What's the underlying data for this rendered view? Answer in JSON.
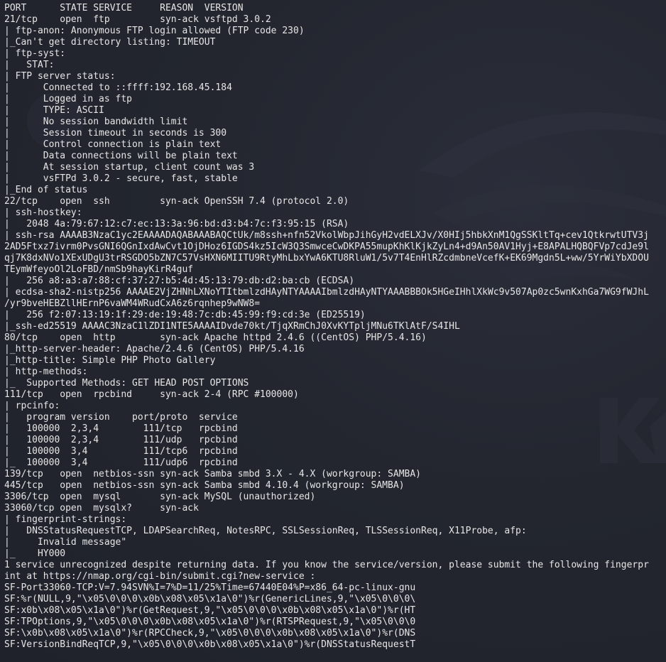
{
  "colors": {
    "background": "#22252f",
    "text": "#e6e6e6"
  },
  "terminal": {
    "lines": [
      "PORT      STATE SERVICE     REASON  VERSION",
      "21/tcp    open  ftp         syn-ack vsftpd 3.0.2",
      "| ftp-anon: Anonymous FTP login allowed (FTP code 230)",
      "|_Can't get directory listing: TIMEOUT",
      "| ftp-syst:",
      "|   STAT:",
      "| FTP server status:",
      "|      Connected to ::ffff:192.168.45.184",
      "|      Logged in as ftp",
      "|      TYPE: ASCII",
      "|      No session bandwidth limit",
      "|      Session timeout in seconds is 300",
      "|      Control connection is plain text",
      "|      Data connections will be plain text",
      "|      At session startup, client count was 3",
      "|      vsFTPd 3.0.2 - secure, fast, stable",
      "|_End of status",
      "22/tcp    open  ssh         syn-ack OpenSSH 7.4 (protocol 2.0)",
      "| ssh-hostkey:",
      "|   2048 4a:79:67:12:c7:ec:13:3a:96:bd:d3:b4:7c:f3:95:15 (RSA)",
      "| ssh-rsa AAAAB3NzaC1yc2EAAAADAQABAAABAQCtUk/m8ssh+nfn52VkolWbpJihGyH2vdELXJv/X0HIj5hbkXnM1QgSSKltTq+cev1QtkrwtUTV3j",
      "2AD5Ftxz7ivrm0PvsGNI6QGnIxdAwCvt1OjDHoz6IGDS4kz5IcW3Q3SmwceCwDKPA55mupKhKlKjkZyLn4+d9An50AV1Hyj+E8APALHQBQFVp7cdJe9l",
      "qj7K8dxNVo1XExUDgU3trRSGDO5bZN7C57VsHXN6MIITU9RtyMhLbxYwA6KTU8RluW1/5v7T4EnHlRZcdmbneVcefK+EK69Mgdn5L+ww/5YrWiYbXDOU",
      "TEymWfeyoOl2LoFBD/nmSb9hayKirR4guf",
      "|   256 a8:a3:a7:88:cf:37:27:b5:4d:45:13:79:db:d2:ba:cb (ECDSA)",
      "| ecdsa-sha2-nistp256 AAAAE2VjZHNhLXNoYTItbmlzdHAyNTYAAAAIbmlzdHAyNTYAAABBBOk5HGeIHhlXkWc9v507Ap0zc5wnKxhGa7WG9fWJhL",
      "/yr9bveHEBZllHErnP6vaWM4WRudCxA6z6rqnhep9wNW8=",
      "|   256 f2:07:13:19:1f:29:de:19:48:7c:db:45:99:f9:cd:3e (ED25519)",
      "|_ssh-ed25519 AAAAC3NzaC1lZDI1NTE5AAAAIDvde70kt/TjqXRmChJ0XvKYTpljMNu6TKlAtF/S4IHL",
      "80/tcp    open  http        syn-ack Apache httpd 2.4.6 ((CentOS) PHP/5.4.16)",
      "|_http-server-header: Apache/2.4.6 (CentOS) PHP/5.4.16",
      "|_http-title: Simple PHP Photo Gallery",
      "| http-methods:",
      "|_  Supported Methods: GET HEAD POST OPTIONS",
      "111/tcp   open  rpcbind     syn-ack 2-4 (RPC #100000)",
      "| rpcinfo:",
      "|   program version    port/proto  service",
      "|   100000  2,3,4        111/tcp   rpcbind",
      "|   100000  2,3,4        111/udp   rpcbind",
      "|   100000  3,4          111/tcp6  rpcbind",
      "|_  100000  3,4          111/udp6  rpcbind",
      "139/tcp   open  netbios-ssn syn-ack Samba smbd 3.X - 4.X (workgroup: SAMBA)",
      "445/tcp   open  netbios-ssn syn-ack Samba smbd 4.10.4 (workgroup: SAMBA)",
      "3306/tcp  open  mysql       syn-ack MySQL (unauthorized)",
      "33060/tcp open  mysqlx?     syn-ack",
      "| fingerprint-strings:",
      "|   DNSStatusRequestTCP, LDAPSearchReq, NotesRPC, SSLSessionReq, TLSSessionReq, X11Probe, afp:",
      "|     Invalid message\"",
      "|_    HY000",
      "1 service unrecognized despite returning data. If you know the service/version, please submit the following fingerpr",
      "int at https://nmap.org/cgi-bin/submit.cgi?new-service :",
      "SF-Port33060-TCP:V=7.94SVN%I=7%D=11/25%Time=67440E04%P=x86_64-pc-linux-gnu",
      "SF:%r(NULL,9,\"\\x05\\0\\0\\0\\x0b\\x08\\x05\\x1a\\0\")%r(GenericLines,9,\"\\x05\\0\\0\\0\\",
      "SF:x0b\\x08\\x05\\x1a\\0\")%r(GetRequest,9,\"\\x05\\0\\0\\0\\x0b\\x08\\x05\\x1a\\0\")%r(HT",
      "SF:TPOptions,9,\"\\x05\\0\\0\\0\\x0b\\x08\\x05\\x1a\\0\")%r(RTSPRequest,9,\"\\x05\\0\\0\\0",
      "SF:\\x0b\\x08\\x05\\x1a\\0\")%r(RPCCheck,9,\"\\x05\\0\\0\\0\\x0b\\x08\\x05\\x1a\\0\")%r(DNS",
      "SF:VersionBindReqTCP,9,\"\\x05\\0\\0\\0\\x0b\\x08\\x05\\x1a\\0\")%r(DNSStatusRequestT"
    ]
  }
}
